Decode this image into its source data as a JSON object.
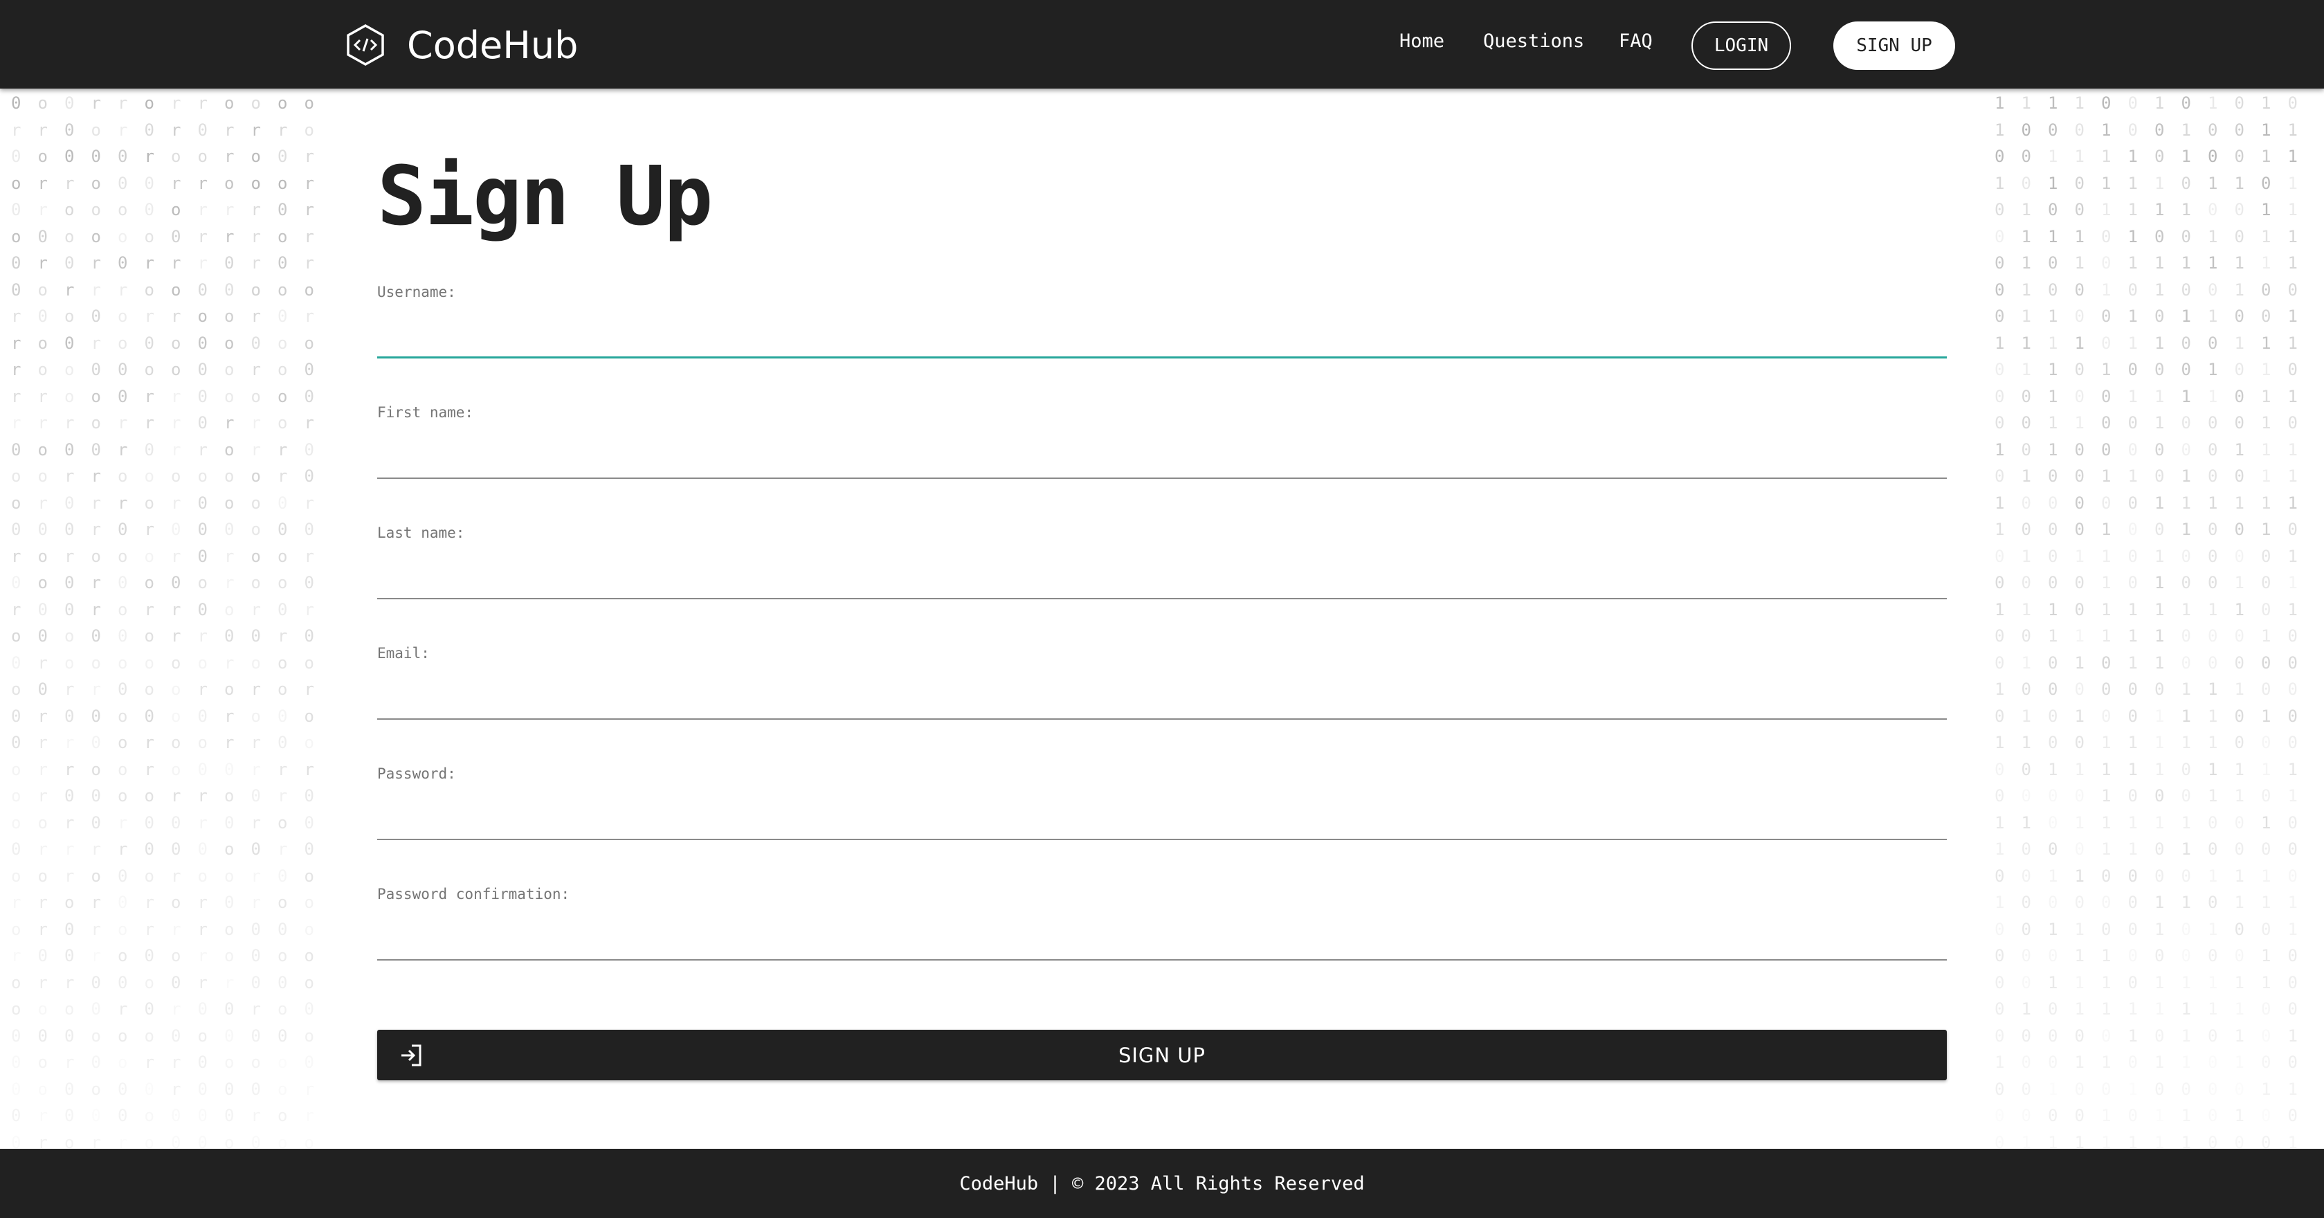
{
  "navbar": {
    "brand_name": "CodeHub",
    "brand_icon": "code-hexagon-icon",
    "links": {
      "home": "Home",
      "questions": "Questions",
      "faq": "FAQ"
    },
    "login_label": "LOGIN",
    "signup_label": "SIGN UP"
  },
  "form": {
    "title": "Sign Up",
    "fields": [
      {
        "label": "Username:",
        "value": ""
      },
      {
        "label": "First name:",
        "value": ""
      },
      {
        "label": "Last name:",
        "value": ""
      },
      {
        "label": "Email:",
        "value": ""
      },
      {
        "label": "Password:",
        "value": ""
      },
      {
        "label": "Password confirmation:",
        "value": ""
      }
    ],
    "submit_label": "SIGN UP",
    "submit_icon": "login-arrow-icon"
  },
  "footer": {
    "text": "CodeHub | © 2023 All Rights Reserved"
  },
  "colors": {
    "dark": "#212121",
    "accent": "#26a69a",
    "text_muted": "#757575"
  }
}
